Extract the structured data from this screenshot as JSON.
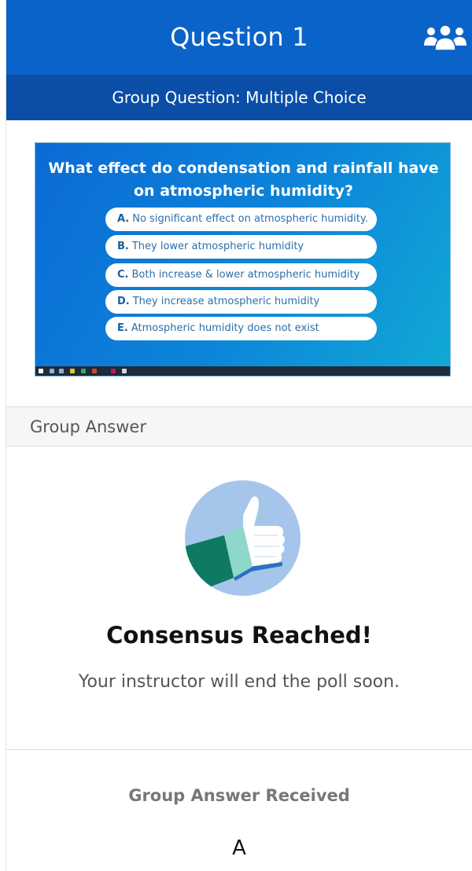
{
  "header": {
    "title": "Question 1",
    "group_icon": "group-users-icon"
  },
  "subheader": {
    "text": "Group Question: Multiple Choice"
  },
  "slide": {
    "question": "What effect do condensation and rainfall have on atmospheric humidity?",
    "options": [
      {
        "letter": "A.",
        "text": "No significant effect on atmospheric humidity."
      },
      {
        "letter": "B.",
        "text": "They lower atmospheric humidity"
      },
      {
        "letter": "C.",
        "text": "Both increase & lower atmospheric humidity"
      },
      {
        "letter": "D.",
        "text": "They increase atmospheric humidity"
      },
      {
        "letter": "E.",
        "text": "Atmospheric humidity does not exist"
      }
    ]
  },
  "group_answer": {
    "section_label": "Group Answer",
    "status_icon": "thumbs-up-icon",
    "status_title": "Consensus Reached!",
    "status_message": "Your instructor will end the poll soon."
  },
  "received": {
    "label": "Group Answer Received",
    "answer": "A"
  },
  "colors": {
    "header": "#0a63c8",
    "subheader": "#0a4ea8",
    "slide_bg": "#0c86d9",
    "thumb_circle": "#a5c6ea",
    "sleeve": "#0f7a63"
  }
}
